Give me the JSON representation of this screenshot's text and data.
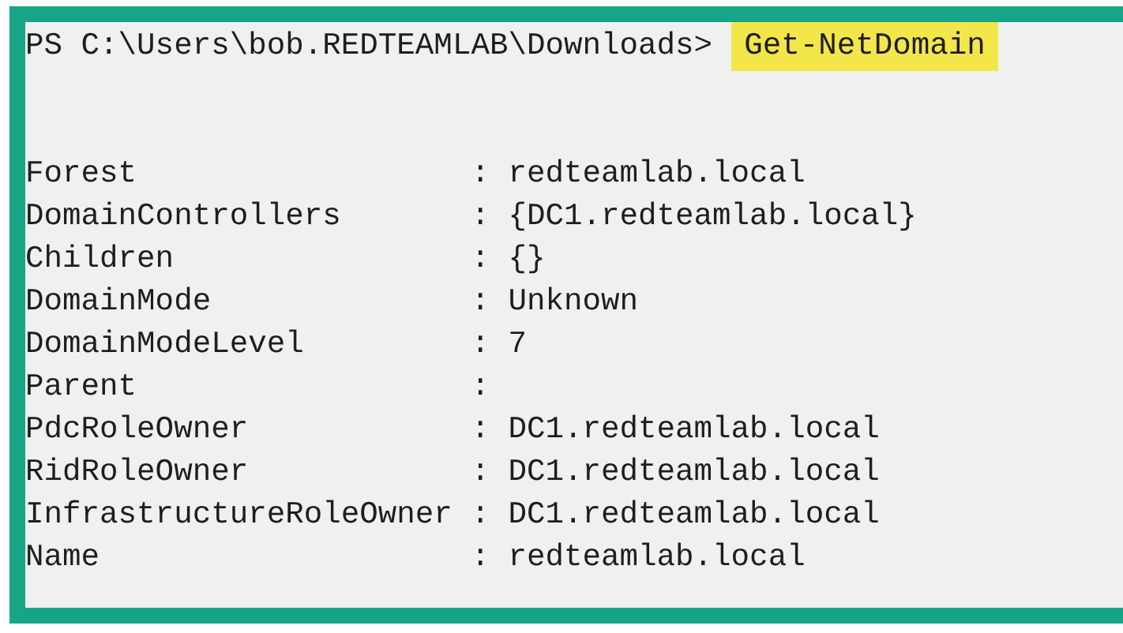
{
  "prompt": {
    "path": "PS C:\\Users\\bob.REDTEAMLAB\\Downloads>",
    "command": "Get-NetDomain"
  },
  "properties": [
    {
      "name": "Forest",
      "separator": ":",
      "value": "redteamlab.local"
    },
    {
      "name": "DomainControllers",
      "separator": ":",
      "value": "{DC1.redteamlab.local}"
    },
    {
      "name": "Children",
      "separator": ":",
      "value": "{}"
    },
    {
      "name": "DomainMode",
      "separator": ":",
      "value": "Unknown"
    },
    {
      "name": "DomainModeLevel",
      "separator": ":",
      "value": "7"
    },
    {
      "name": "Parent",
      "separator": ":"
    },
    {
      "name": "PdcRoleOwner",
      "separator": ":",
      "value": "DC1.redteamlab.local"
    },
    {
      "name": "RidRoleOwner",
      "separator": ":",
      "value": "DC1.redteamlab.local"
    },
    {
      "name": "InfrastructureRoleOwner",
      "separator": ":",
      "value": "DC1.redteamlab.local"
    },
    {
      "name": "Name",
      "separator": ":",
      "value": "redteamlab.local"
    }
  ]
}
